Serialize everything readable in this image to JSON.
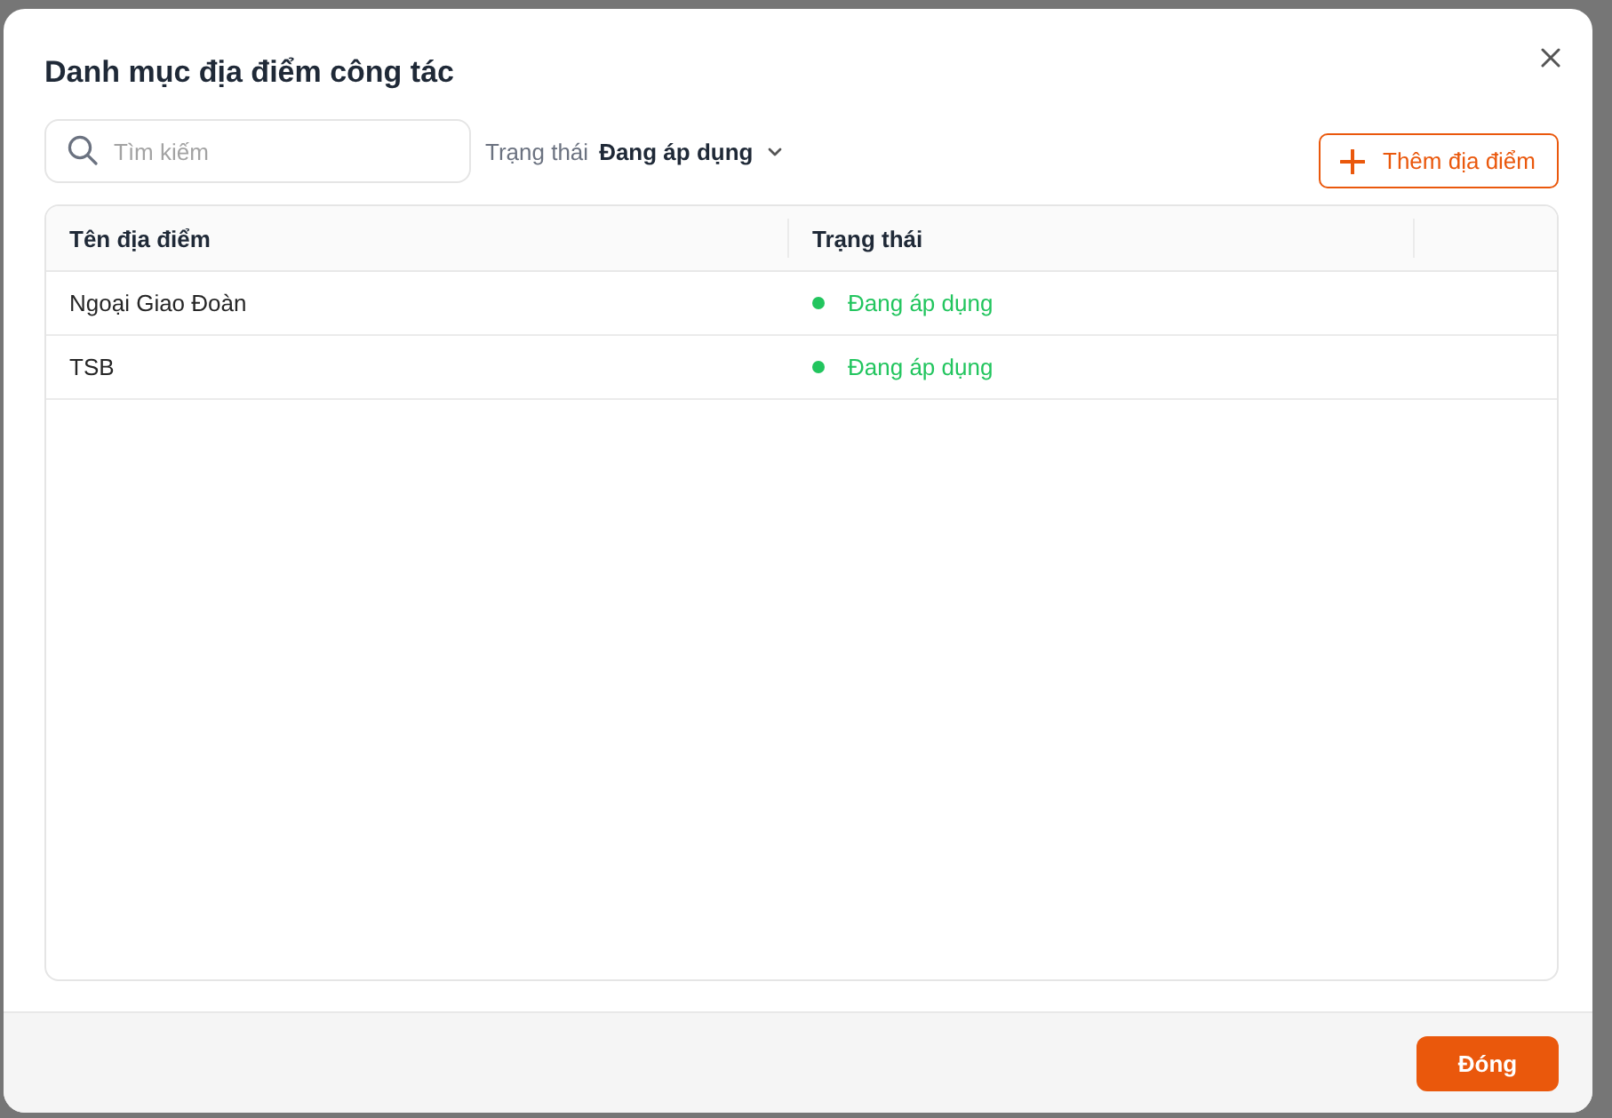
{
  "dialog": {
    "title": "Danh mục địa điểm công tác"
  },
  "search": {
    "placeholder": "Tìm kiếm"
  },
  "filter": {
    "label": "Trạng thái",
    "value": "Đang áp dụng"
  },
  "add_button": {
    "label": "Thêm địa điểm"
  },
  "table": {
    "columns": [
      "Tên địa điểm",
      "Trạng thái"
    ],
    "rows": [
      {
        "name": "Ngoại Giao Đoàn",
        "status": {
          "text": "Đang áp dụng",
          "color": "#22c55e"
        }
      },
      {
        "name": "TSB",
        "status": {
          "text": "Đang áp dụng",
          "color": "#22c55e"
        }
      }
    ]
  },
  "footer": {
    "buttons": [
      "Đóng"
    ]
  }
}
